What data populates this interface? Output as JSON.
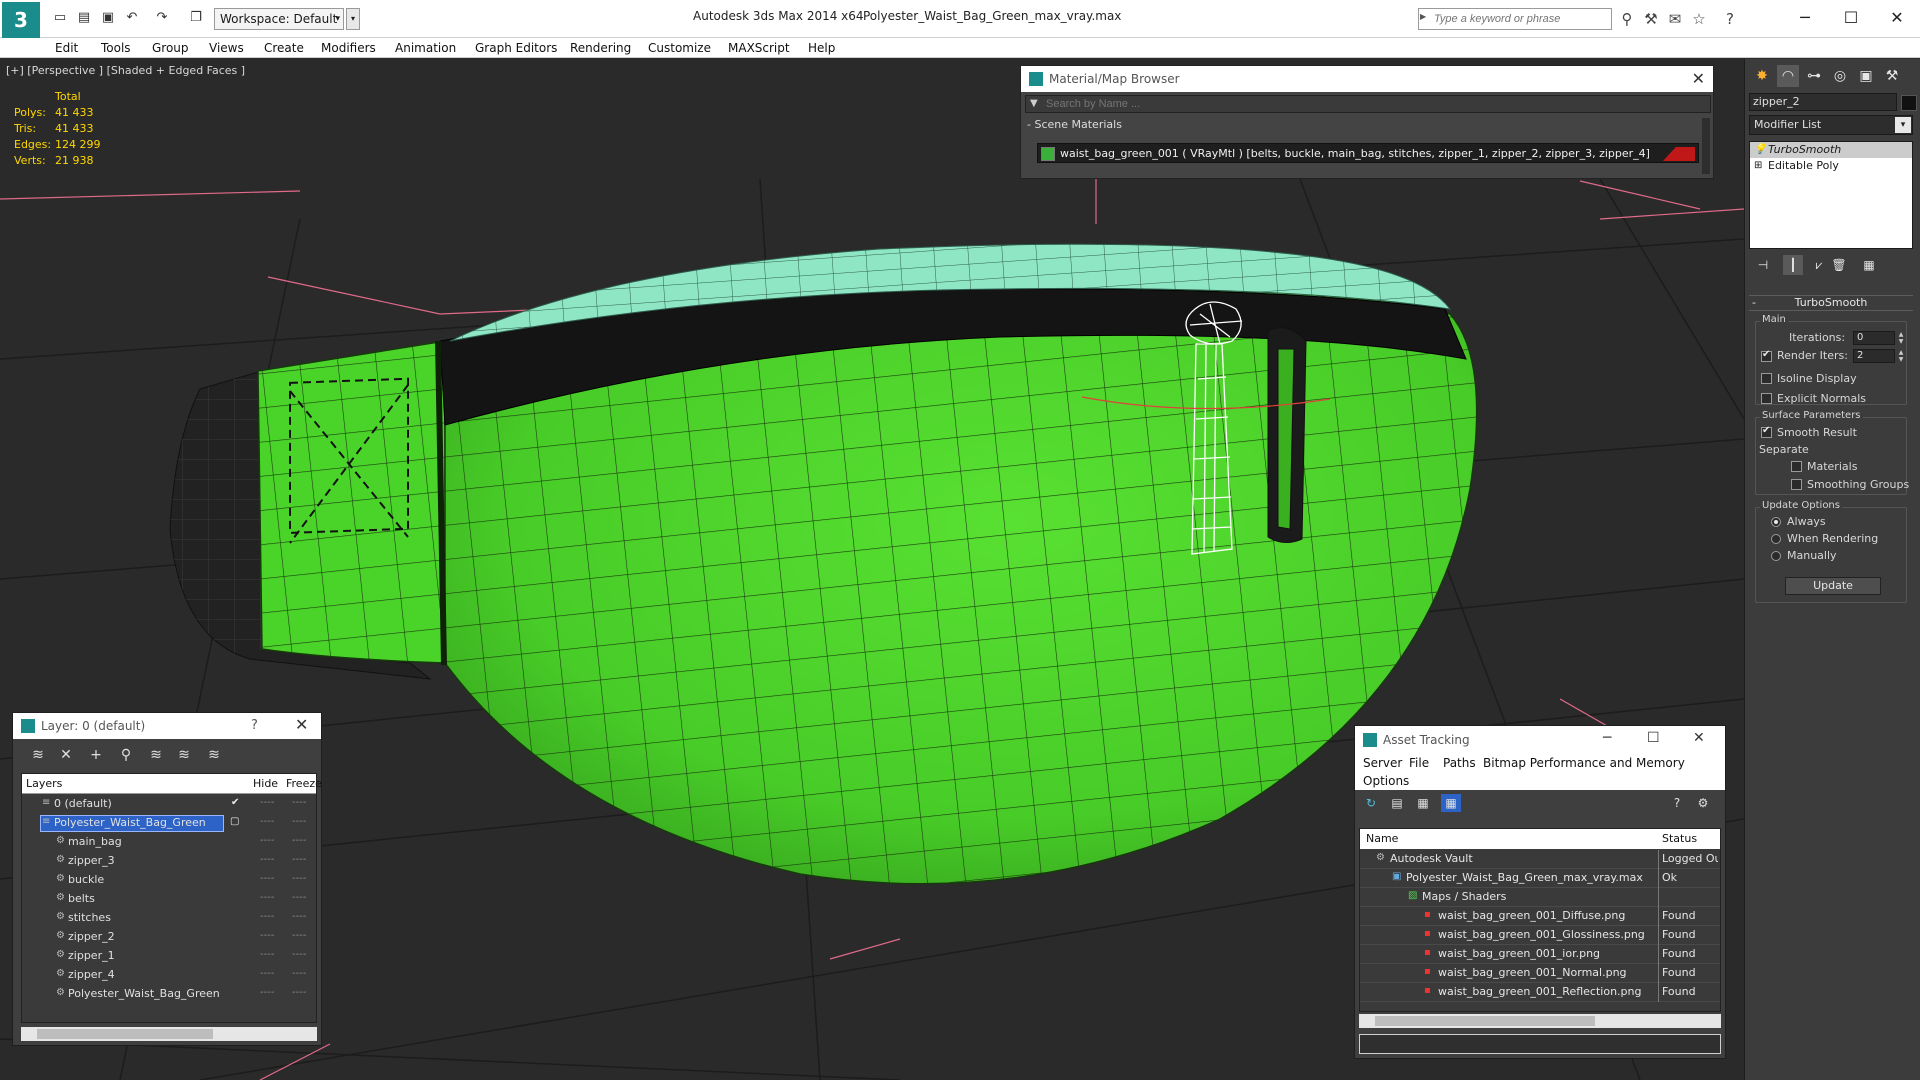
{
  "titlebar": {
    "workspace": "Workspace: Default",
    "app_title": "Autodesk 3ds Max  2014 x64",
    "file_title": "Polyester_Waist_Bag_Green_max_vray.max",
    "search_placeholder": "Type a keyword or phrase"
  },
  "menu": [
    "Edit",
    "Tools",
    "Group",
    "Views",
    "Create",
    "Modifiers",
    "Animation",
    "Graph Editors",
    "Rendering",
    "Customize",
    "MAXScript",
    "Help"
  ],
  "viewport": {
    "label": "[+] [Perspective ] [Shaded + Edged Faces ]",
    "stats": {
      "total_label": "Total",
      "rows": [
        {
          "label": "Polys:",
          "value": "41 433"
        },
        {
          "label": "Tris:",
          "value": "41 433"
        },
        {
          "label": "Edges:",
          "value": "124 299"
        },
        {
          "label": "Verts:",
          "value": "21 938"
        }
      ]
    }
  },
  "command_panel": {
    "object_name": "zipper_2",
    "modifier_list": "Modifier List",
    "stack": [
      "TurboSmooth",
      "Editable Poly"
    ],
    "rollout_title": "TurboSmooth",
    "main_label": "Main",
    "iterations_label": "Iterations:",
    "iterations_value": "0",
    "render_iters_label": "Render Iters:",
    "render_iters_value": "2",
    "isoline_label": "Isoline Display",
    "explicit_normals_label": "Explicit Normals",
    "surface_params_label": "Surface Parameters",
    "smooth_result_label": "Smooth Result",
    "separate_label": "Separate",
    "materials_label": "Materials",
    "smoothing_groups_label": "Smoothing Groups",
    "update_options_label": "Update Options",
    "always_label": "Always",
    "when_rendering_label": "When Rendering",
    "manually_label": "Manually",
    "update_button": "Update"
  },
  "material_browser": {
    "title": "Material/Map Browser",
    "search_placeholder": "Search by Name ...",
    "group": "Scene Materials",
    "row": "waist_bag_green_001  ( VRayMtl )  [belts, buckle, main_bag, stitches, zipper_1, zipper_2, zipper_3, zipper_4]"
  },
  "layer_dialog": {
    "title": "Layer: 0 (default)",
    "help": "?",
    "col_layers": "Layers",
    "col_hide": "Hide",
    "col_freeze": "Freeze",
    "rows": [
      {
        "name": "0 (default)",
        "level": 0,
        "checked": true
      },
      {
        "name": "Polyester_Waist_Bag_Green",
        "level": 0,
        "selected": true
      },
      {
        "name": "main_bag",
        "level": 1
      },
      {
        "name": "zipper_3",
        "level": 1
      },
      {
        "name": "buckle",
        "level": 1
      },
      {
        "name": "belts",
        "level": 1
      },
      {
        "name": "stitches",
        "level": 1
      },
      {
        "name": "zipper_2",
        "level": 1
      },
      {
        "name": "zipper_1",
        "level": 1
      },
      {
        "name": "zipper_4",
        "level": 1
      },
      {
        "name": "Polyester_Waist_Bag_Green",
        "level": 1
      }
    ]
  },
  "asset_tracking": {
    "title": "Asset Tracking",
    "menu": [
      "Server",
      "File",
      "Paths",
      "Bitmap Performance and Memory",
      "Options"
    ],
    "col_name": "Name",
    "col_status": "Status",
    "rows": [
      {
        "name": "Autodesk Vault",
        "level": 0,
        "status": "Logged Out",
        "icon": "vault"
      },
      {
        "name": "Polyester_Waist_Bag_Green_max_vray.max",
        "level": 1,
        "status": "Ok",
        "icon": "max"
      },
      {
        "name": "Maps / Shaders",
        "level": 2,
        "status": "",
        "icon": "maps"
      },
      {
        "name": "waist_bag_green_001_Diffuse.png",
        "level": 3,
        "status": "Found",
        "icon": "png"
      },
      {
        "name": "waist_bag_green_001_Glossiness.png",
        "level": 3,
        "status": "Found",
        "icon": "png"
      },
      {
        "name": "waist_bag_green_001_ior.png",
        "level": 3,
        "status": "Found",
        "icon": "png"
      },
      {
        "name": "waist_bag_green_001_Normal.png",
        "level": 3,
        "status": "Found",
        "icon": "png"
      },
      {
        "name": "waist_bag_green_001_Reflection.png",
        "level": 3,
        "status": "Found",
        "icon": "png"
      }
    ]
  },
  "colors": {
    "bag_green": "#4cd42c",
    "bag_top": "#8ee6c4",
    "selection_blue": "#2d62c7",
    "stats_yellow": "#ffd700"
  }
}
